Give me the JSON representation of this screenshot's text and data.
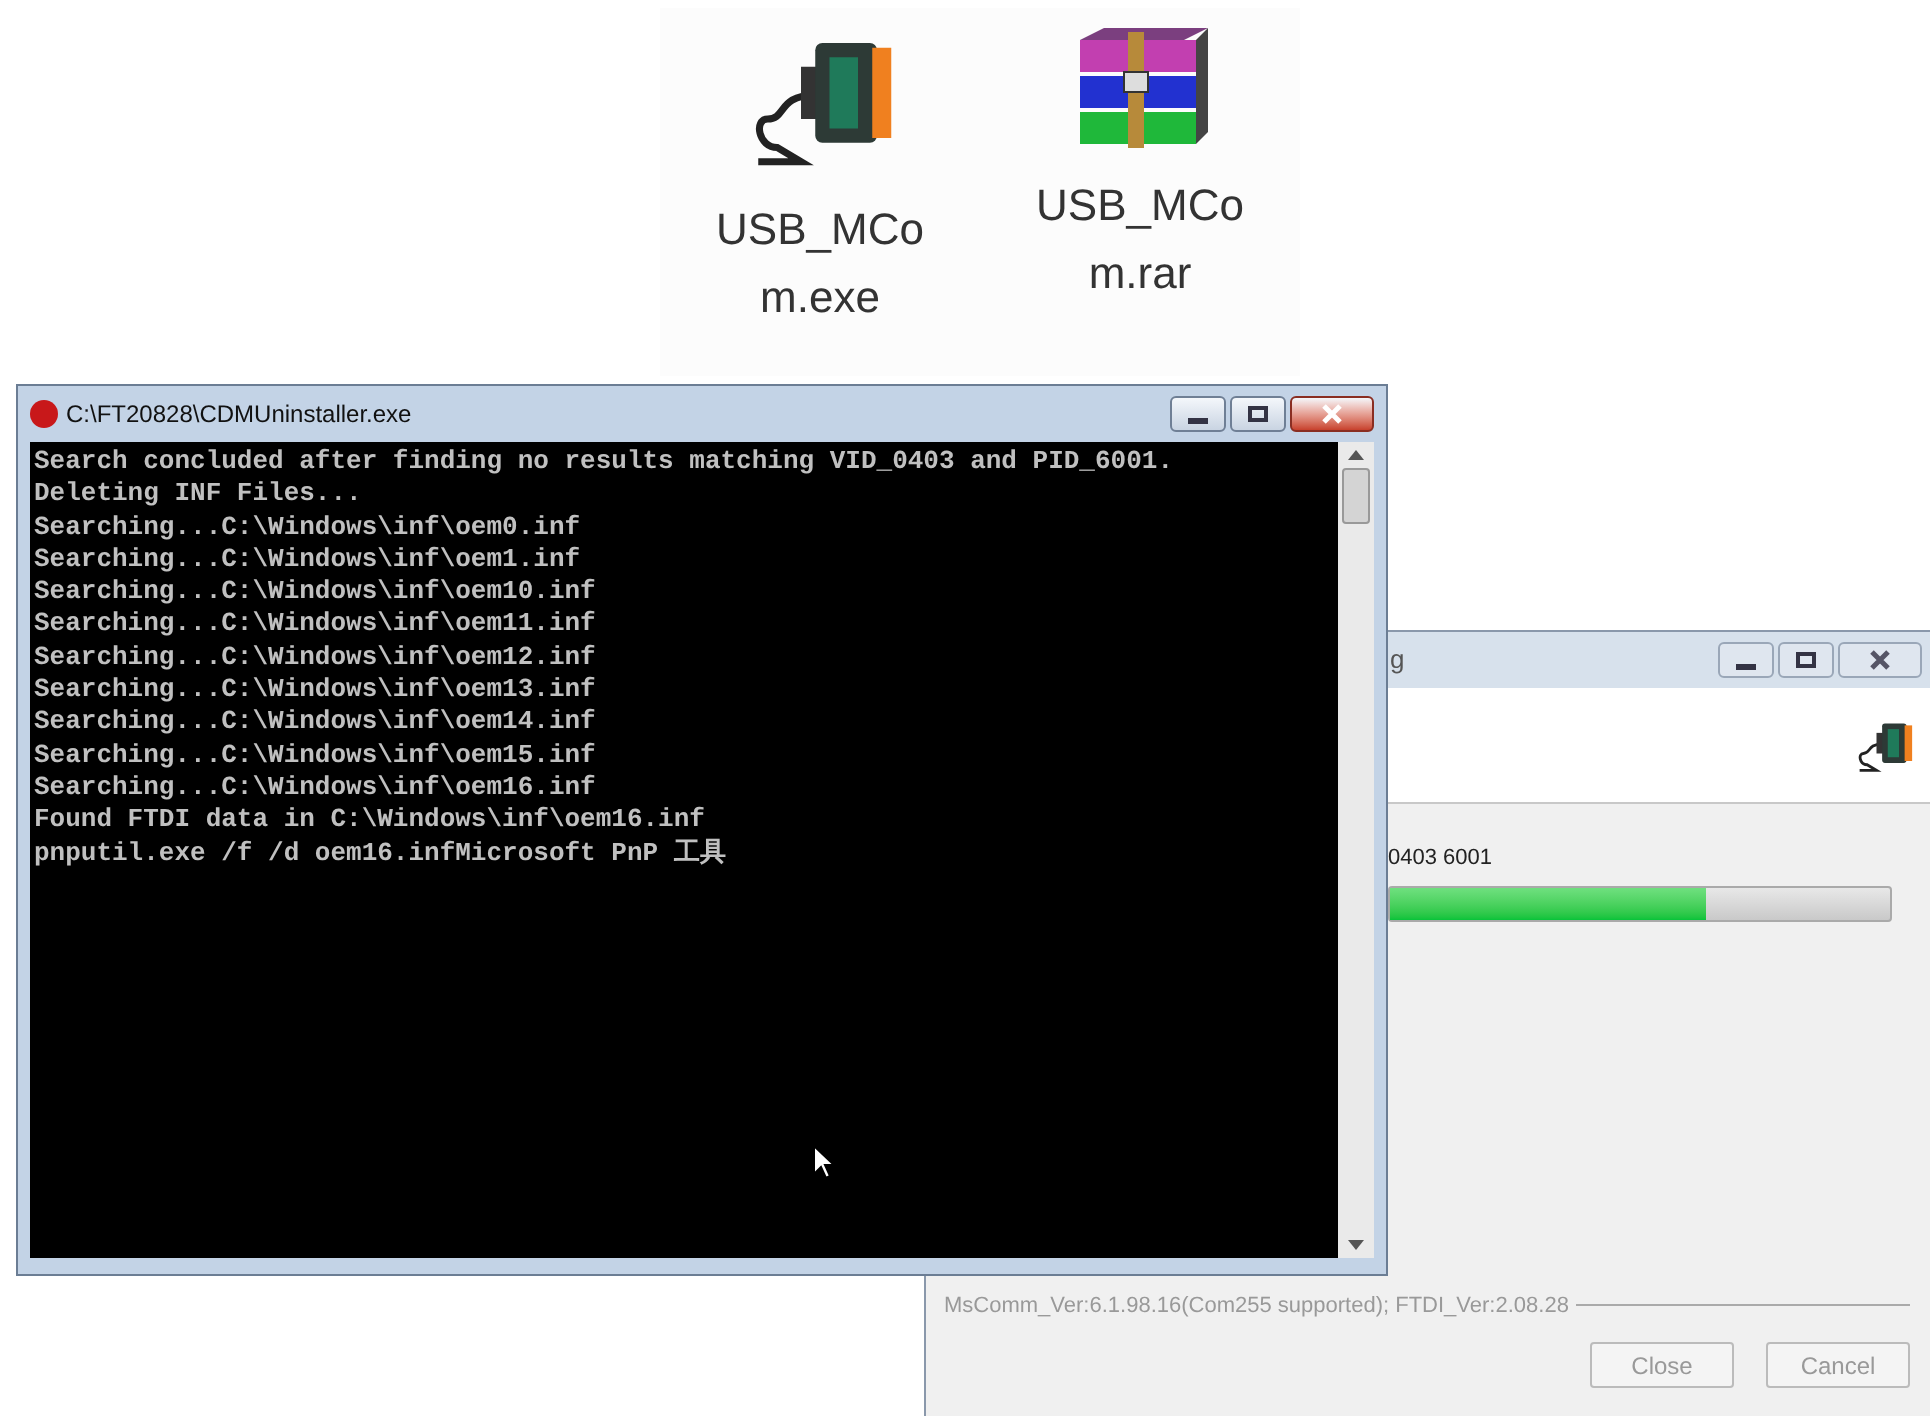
{
  "files": [
    {
      "kind": "exe",
      "label_lines": [
        "USB_MCo",
        "m.exe"
      ]
    },
    {
      "kind": "archive",
      "label_lines": [
        "USB_MCo",
        "m.rar"
      ]
    }
  ],
  "dialog": {
    "title": "g",
    "device_text": "0403 6001",
    "progress": {
      "level": 0.63
    },
    "version_text": "MsComm_Ver:6.1.98.16(Com255 supported); FTDI_Ver:2.08.28",
    "buttons": [
      {
        "label": "Close",
        "disabled": true
      },
      {
        "label": "Cancel",
        "disabled": true
      }
    ]
  },
  "console": {
    "title": "C:\\FT20828\\CDMUninstaller.exe",
    "lines": [
      "Search concluded after finding no results matching VID_0403 and PID_6001.",
      "Deleting INF Files...",
      "Searching...C:\\Windows\\inf\\oem0.inf",
      "Searching...C:\\Windows\\inf\\oem1.inf",
      "Searching...C:\\Windows\\inf\\oem10.inf",
      "Searching...C:\\Windows\\inf\\oem11.inf",
      "Searching...C:\\Windows\\inf\\oem12.inf",
      "Searching...C:\\Windows\\inf\\oem13.inf",
      "Searching...C:\\Windows\\inf\\oem14.inf",
      "Searching...C:\\Windows\\inf\\oem15.inf",
      "Searching...C:\\Windows\\inf\\oem16.inf",
      "Found FTDI data in C:\\Windows\\inf\\oem16.inf",
      "pnputil.exe /f /d oem16.infMicrosoft PnP 工具"
    ]
  }
}
